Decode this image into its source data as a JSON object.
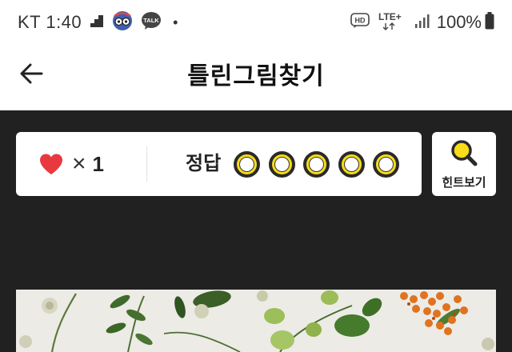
{
  "status_bar": {
    "carrier_time": "KT 1:40",
    "dot": "•",
    "talk_badge": "TALK",
    "hd_badge": "HD",
    "network": "LTE+",
    "battery_percent": "100%"
  },
  "header": {
    "title": "틀린그림찾기",
    "back_icon": "arrow-left-icon"
  },
  "game": {
    "lives": {
      "icon": "heart-icon",
      "times": "×",
      "count": "1"
    },
    "answer": {
      "label": "정답",
      "found": 0,
      "total": 5
    },
    "hint_button": {
      "icon": "magnifier-icon",
      "label": "힌트보기"
    }
  },
  "colors": {
    "game_background": "#212121",
    "heart": "#e8393f",
    "slot_yellow": "#f7dc1a"
  }
}
